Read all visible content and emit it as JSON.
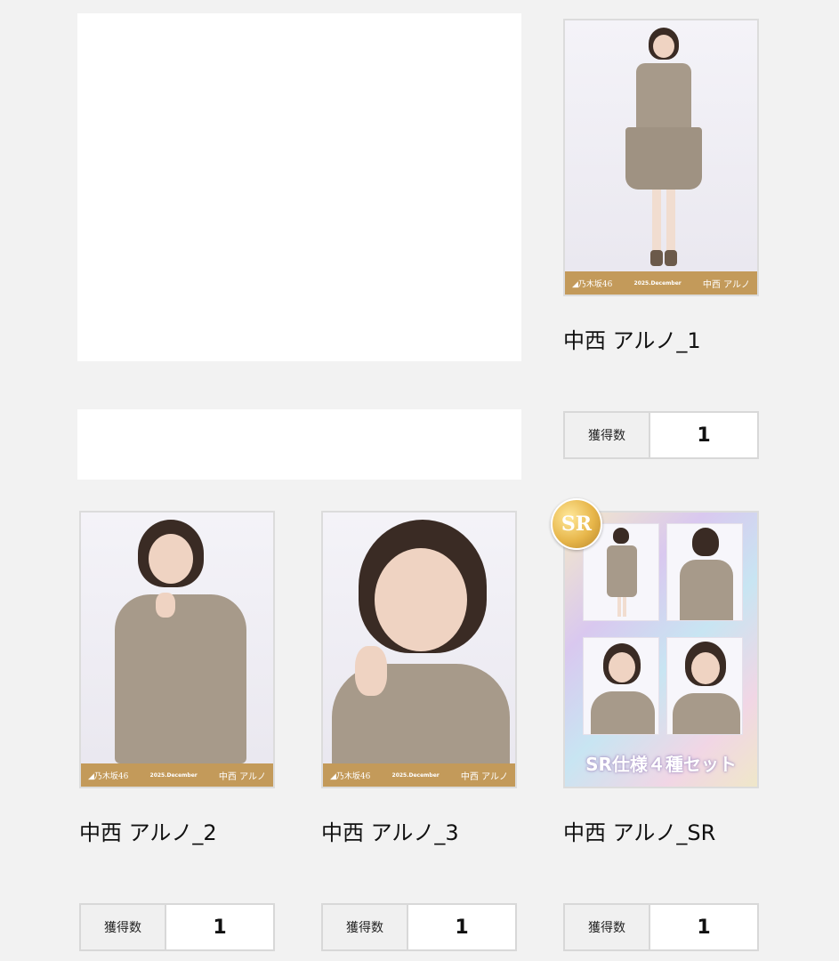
{
  "blank_items": [
    "",
    ""
  ],
  "cards": [
    {
      "title": "中西 アルノ_1",
      "count_label": "獲得数",
      "count": "1",
      "strip": {
        "logo": "◢乃木坂46",
        "date": "2025.December",
        "sig": "中西 アルノ"
      }
    },
    {
      "title": "中西 アルノ_2",
      "count_label": "獲得数",
      "count": "1",
      "strip": {
        "logo": "◢乃木坂46",
        "date": "2025.December",
        "sig": "中西 アルノ"
      }
    },
    {
      "title": "中西 アルノ_3",
      "count_label": "獲得数",
      "count": "1",
      "strip": {
        "logo": "◢乃木坂46",
        "date": "2025.December",
        "sig": "中西 アルノ"
      }
    },
    {
      "title": "中西 アルノ_SR",
      "count_label": "獲得数",
      "count": "1",
      "badge": "SR",
      "caption": "SR仕様４種セット"
    }
  ],
  "colors": {
    "strip": "#c39a5a",
    "badge_gold": "#e7b64a",
    "page_bg": "#f2f2f2"
  }
}
